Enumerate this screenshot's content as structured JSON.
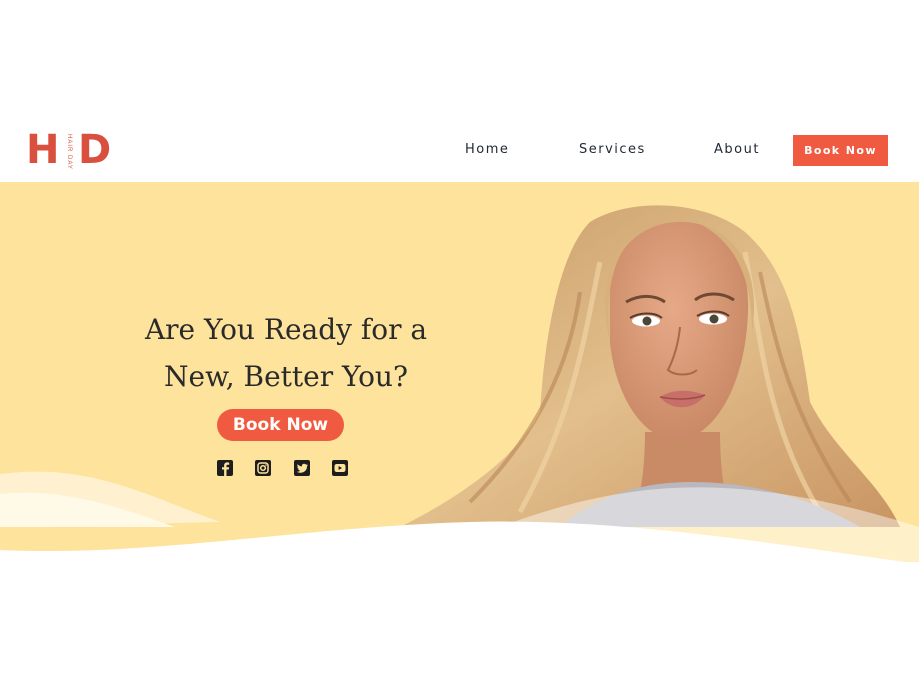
{
  "brand": {
    "letter_left": "H",
    "letter_right": "D",
    "tagline": "HAIR DAY",
    "color": "#d9503f"
  },
  "nav": {
    "items": [
      {
        "label": "Home"
      },
      {
        "label": "Services"
      },
      {
        "label": "About"
      }
    ],
    "cta_label": "Book Now"
  },
  "hero": {
    "headline_line1": "Are You Ready for a",
    "headline_line2": "New, Better You?",
    "cta_label": "Book Now",
    "background": "#fde39c",
    "accent": "#f05a40",
    "social_icons": [
      "facebook-icon",
      "instagram-icon",
      "twitter-icon",
      "youtube-icon"
    ]
  }
}
